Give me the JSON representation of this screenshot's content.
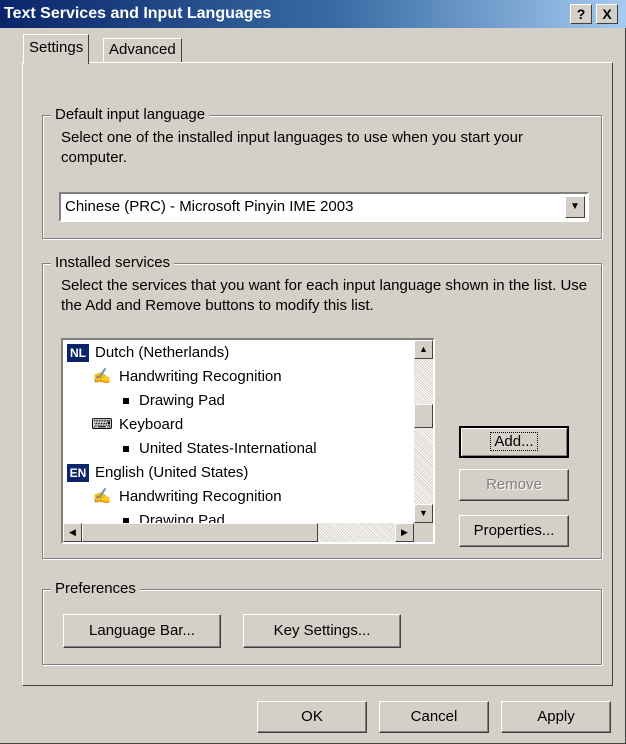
{
  "window": {
    "title": "Text Services and Input Languages",
    "help_btn": "?",
    "close_btn": "X"
  },
  "tabs": [
    {
      "label": "Settings",
      "active": true
    },
    {
      "label": "Advanced",
      "active": false
    }
  ],
  "default_input": {
    "legend": "Default input language",
    "description": "Select one of the installed input languages to use when you start your computer.",
    "selected": "Chinese (PRC) - Microsoft Pinyin IME 2003"
  },
  "installed_services": {
    "legend": "Installed services",
    "description": "Select the services that you want for each input language shown in the list. Use the Add and Remove buttons to modify this list.",
    "items": [
      {
        "type": "language",
        "code": "NL",
        "label": "Dutch (Netherlands)"
      },
      {
        "type": "service",
        "icon": "pen-icon",
        "label": "Handwriting Recognition"
      },
      {
        "type": "sub",
        "label": "Drawing Pad"
      },
      {
        "type": "service",
        "icon": "keyboard-icon",
        "label": "Keyboard"
      },
      {
        "type": "sub",
        "label": "United States-International"
      },
      {
        "type": "language",
        "code": "EN",
        "label": "English (United States)"
      },
      {
        "type": "service",
        "icon": "pen-icon",
        "label": "Handwriting Recognition"
      },
      {
        "type": "sub",
        "label": "Drawing Pad"
      }
    ],
    "add_label": "Add...",
    "remove_label": "Remove",
    "properties_label": "Properties..."
  },
  "preferences": {
    "legend": "Preferences",
    "language_bar_label": "Language Bar...",
    "key_settings_label": "Key Settings..."
  },
  "footer": {
    "ok_label": "OK",
    "cancel_label": "Cancel",
    "apply_label": "Apply"
  }
}
